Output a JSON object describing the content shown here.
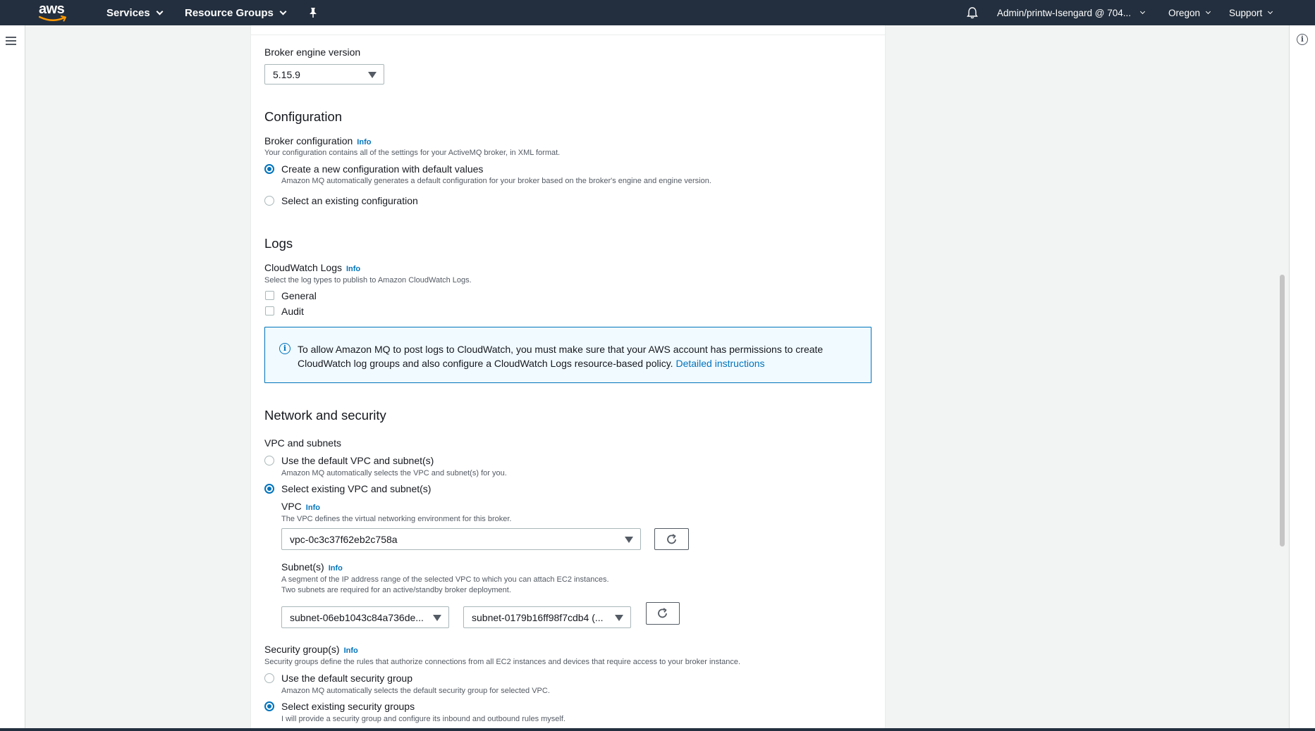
{
  "nav": {
    "logo_text": "aws",
    "services": "Services",
    "resource_groups": "Resource Groups",
    "account": "Admin/printw-Isengard @ 704...",
    "region": "Oregon",
    "support": "Support"
  },
  "engine": {
    "label": "Broker engine version",
    "value": "5.15.9"
  },
  "configuration": {
    "heading": "Configuration",
    "label": "Broker configuration",
    "info": "Info",
    "description": "Your configuration contains all of the settings for your ActiveMQ broker, in XML format.",
    "options": [
      {
        "label": "Create a new configuration with default values",
        "desc": "Amazon MQ automatically generates a default configuration for your broker based on the broker's engine and engine version.",
        "selected": true
      },
      {
        "label": "Select an existing configuration",
        "selected": false
      }
    ]
  },
  "logs": {
    "heading": "Logs",
    "label": "CloudWatch Logs",
    "info": "Info",
    "description": "Select the log types to publish to Amazon CloudWatch Logs.",
    "general": "General",
    "audit": "Audit",
    "alert_text": "To allow Amazon MQ to post logs to CloudWatch, you must make sure that your AWS account has permissions to create CloudWatch log groups and also configure a CloudWatch Logs resource-based policy.",
    "alert_link": "Detailed instructions"
  },
  "network": {
    "heading": "Network and security",
    "vpc_subnets_label": "VPC and subnets",
    "default_vpc": "Use the default VPC and subnet(s)",
    "default_vpc_desc": "Amazon MQ automatically selects the VPC and subnet(s) for you.",
    "existing_vpc": "Select existing VPC and subnet(s)",
    "vpc_label": "VPC",
    "vpc_info": "Info",
    "vpc_desc": "The VPC defines the virtual networking environment for this broker.",
    "vpc_value": "vpc-0c3c37f62eb2c758a",
    "subnet_label": "Subnet(s)",
    "subnet_info": "Info",
    "subnet_desc1": "A segment of the IP address range of the selected VPC to which you can attach EC2 instances.",
    "subnet_desc2": "Two subnets are required for an active/standby broker deployment.",
    "subnet1": "subnet-06eb1043c84a736de...",
    "subnet2": "subnet-0179b16ff98f7cdb4 (...",
    "sg_label": "Security group(s)",
    "sg_info": "Info",
    "sg_desc": "Security groups define the rules that authorize connections from all EC2 instances and devices that require access to your broker instance.",
    "sg_default": "Use the default security group",
    "sg_default_desc": "Amazon MQ automatically selects the default security group for selected VPC.",
    "sg_existing": "Select existing security groups",
    "sg_existing_desc": "I will provide a security group and configure its inbound and outbound rules myself."
  },
  "colors": {
    "nav_bg": "#232f3e",
    "accent": "#0073bb",
    "alert_bg": "#f1faff"
  }
}
